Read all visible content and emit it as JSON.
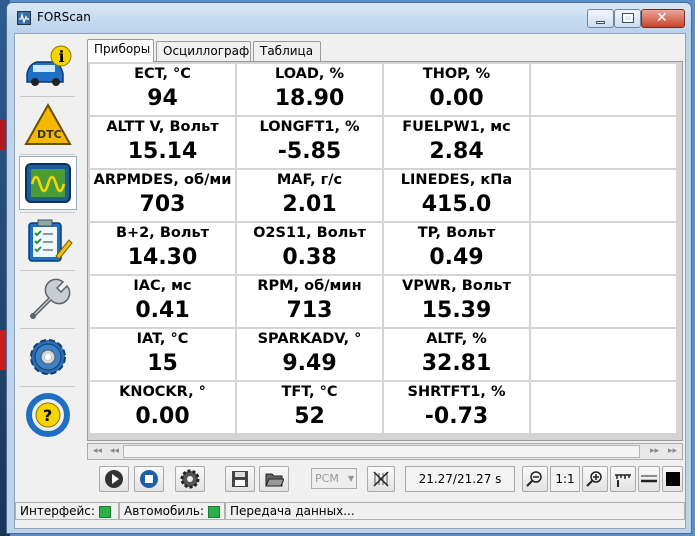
{
  "window": {
    "title": "FORScan",
    "close_glyph": "✕"
  },
  "sidebar": {
    "items": [
      {
        "name": "vehicle-info",
        "icon": "car-info-icon"
      },
      {
        "name": "dtc",
        "icon": "dtc-icon",
        "label": "DTC"
      },
      {
        "name": "oscilloscope",
        "icon": "oscilloscope-icon"
      },
      {
        "name": "tests",
        "icon": "checklist-icon"
      },
      {
        "name": "service",
        "icon": "wrench-icon"
      },
      {
        "name": "settings",
        "icon": "gear-icon"
      },
      {
        "name": "help",
        "icon": "help-icon",
        "label": "?"
      }
    ],
    "active": "oscilloscope"
  },
  "tabs": [
    {
      "label": "Приборы",
      "active": true
    },
    {
      "label": "Осциллограф",
      "active": false
    },
    {
      "label": "Таблица",
      "active": false
    }
  ],
  "gauges": [
    {
      "label": "ECT, °C",
      "value": "94"
    },
    {
      "label": "LOAD, %",
      "value": "18.90"
    },
    {
      "label": "THOP, %",
      "value": "0.00"
    },
    {
      "label": "",
      "value": ""
    },
    {
      "label": "ALTT V, Вольт",
      "value": "15.14"
    },
    {
      "label": "LONGFT1, %",
      "value": "-5.85"
    },
    {
      "label": "FUELPW1, мс",
      "value": "2.84"
    },
    {
      "label": "",
      "value": ""
    },
    {
      "label": "ARPMDES, об/ми",
      "value": "703"
    },
    {
      "label": "MAF, г/с",
      "value": "2.01"
    },
    {
      "label": "LINEDES, кПа",
      "value": "415.0"
    },
    {
      "label": "",
      "value": ""
    },
    {
      "label": "B+2, Вольт",
      "value": "14.30"
    },
    {
      "label": "O2S11, Вольт",
      "value": "0.38"
    },
    {
      "label": "TP, Вольт",
      "value": "0.49"
    },
    {
      "label": "",
      "value": ""
    },
    {
      "label": "IAC, мс",
      "value": "0.41"
    },
    {
      "label": "RPM, об/мин",
      "value": "713"
    },
    {
      "label": "VPWR, Вольт",
      "value": "15.39"
    },
    {
      "label": "",
      "value": ""
    },
    {
      "label": "IAT, °C",
      "value": "15"
    },
    {
      "label": "SPARKADV, °",
      "value": "9.49"
    },
    {
      "label": "ALTF, %",
      "value": "32.81"
    },
    {
      "label": "",
      "value": ""
    },
    {
      "label": "KNOCKR, °",
      "value": "0.00"
    },
    {
      "label": "TFT, °C",
      "value": "52"
    },
    {
      "label": "SHRTFT1, %",
      "value": "-0.73"
    },
    {
      "label": "",
      "value": ""
    }
  ],
  "scroll": {
    "left_end": "◂◂",
    "left": "◂◂",
    "right": "▸▸",
    "right_end": "▸▸"
  },
  "toolbar": {
    "module_select": "PCM",
    "time": "21.27/21.27 s",
    "zoom_ratio": "1:1"
  },
  "status": {
    "interface_label": "Интерфейс:",
    "vehicle_label": "Автомобиль:",
    "message": "Передача данных...",
    "led_color": "#2bb04a"
  }
}
